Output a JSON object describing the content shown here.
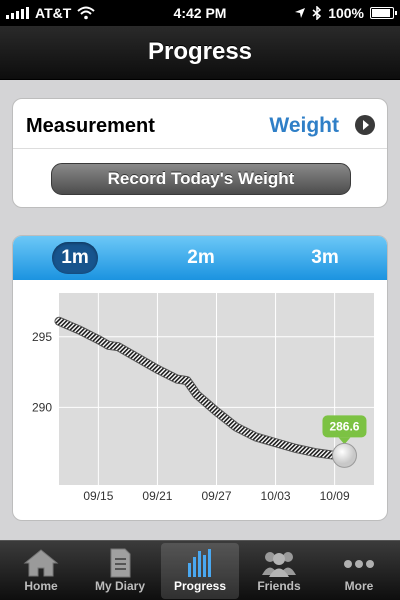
{
  "status_bar": {
    "carrier": "AT&T",
    "time": "4:42 PM",
    "battery": "100%"
  },
  "nav": {
    "title": "Progress"
  },
  "measurement": {
    "label": "Measurement",
    "value": "Weight",
    "record_button": "Record Today's Weight"
  },
  "range_tabs": [
    {
      "label": "1m",
      "active": true
    },
    {
      "label": "2m",
      "active": false
    },
    {
      "label": "3m",
      "active": false
    }
  ],
  "chart_data": {
    "type": "line",
    "x_ticks": [
      "09/15",
      "09/21",
      "09/27",
      "10/03",
      "10/09"
    ],
    "y_ticks": [
      295,
      290
    ],
    "ylim": [
      284.5,
      298.1
    ],
    "xlim": [
      0,
      32
    ],
    "grid": true,
    "series": [
      {
        "x": [
          0,
          2,
          4,
          5,
          6,
          7,
          8,
          10,
          12,
          13,
          14,
          16,
          18,
          20,
          22,
          24,
          26,
          28,
          29
        ],
        "y": [
          296.1,
          295.5,
          294.8,
          294.4,
          294.3,
          293.9,
          293.5,
          292.7,
          292.0,
          291.9,
          290.9,
          289.7,
          288.6,
          287.9,
          287.5,
          287.1,
          286.8,
          286.6,
          286.6
        ]
      }
    ],
    "callout": "286.6",
    "callout_color": "#7cc243"
  },
  "tabs": [
    {
      "label": "Home",
      "icon": "home-icon"
    },
    {
      "label": "My Diary",
      "icon": "diary-icon"
    },
    {
      "label": "Progress",
      "icon": "progress-icon",
      "active": true
    },
    {
      "label": "Friends",
      "icon": "friends-icon"
    },
    {
      "label": "More",
      "icon": "more-icon"
    }
  ]
}
